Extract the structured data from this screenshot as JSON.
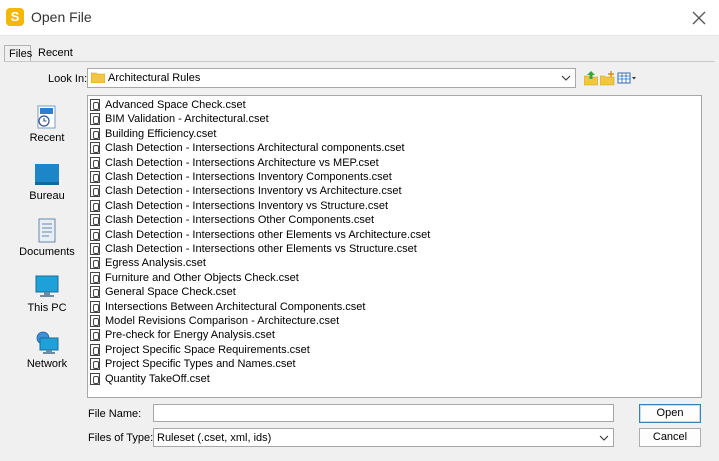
{
  "window": {
    "title": "Open File",
    "app_icon_letter": "S",
    "accent": "#f5b800"
  },
  "tabs": [
    {
      "label": "Files",
      "active": true
    },
    {
      "label": "Recent",
      "active": false
    }
  ],
  "lookin": {
    "label": "Look In:",
    "value": "Architectural Rules"
  },
  "toolbar": {
    "up_icon": "folder-up-icon",
    "new_folder_icon": "new-folder-icon",
    "view_icon": "view-menu-icon"
  },
  "places": [
    {
      "label": "Recent",
      "icon": "recent-icon"
    },
    {
      "label": "Bureau",
      "icon": "desktop-icon"
    },
    {
      "label": "Documents",
      "icon": "documents-icon"
    },
    {
      "label": "This PC",
      "icon": "computer-icon"
    },
    {
      "label": "Network",
      "icon": "network-icon"
    }
  ],
  "files": [
    "Advanced Space Check.cset",
    "BIM Validation - Architectural.cset",
    "Building Efficiency.cset",
    "Clash Detection - Intersections Architectural components.cset",
    "Clash Detection - Intersections Architecture vs MEP.cset",
    "Clash Detection - Intersections Inventory Components.cset",
    "Clash Detection - Intersections Inventory vs Architecture.cset",
    "Clash Detection - Intersections Inventory vs Structure.cset",
    "Clash Detection - Intersections Other Components.cset",
    "Clash Detection - Intersections other Elements vs Architecture.cset",
    "Clash Detection - Intersections other Elements vs Structure.cset",
    "Egress Analysis.cset",
    "Furniture and Other Objects Check.cset",
    "General Space Check.cset",
    "Intersections Between Architectural Components.cset",
    "Model Revisions Comparison - Architecture.cset",
    "Pre-check for Energy Analysis.cset",
    "Project Specific Space Requirements.cset",
    "Project Specific Types and Names.cset",
    "Quantity TakeOff.cset"
  ],
  "filename": {
    "label": "File Name:",
    "value": "",
    "placeholder": ""
  },
  "filetype": {
    "label": "Files of Type:",
    "value": "Ruleset (.cset, xml, ids)"
  },
  "buttons": {
    "open": "Open",
    "cancel": "Cancel"
  }
}
